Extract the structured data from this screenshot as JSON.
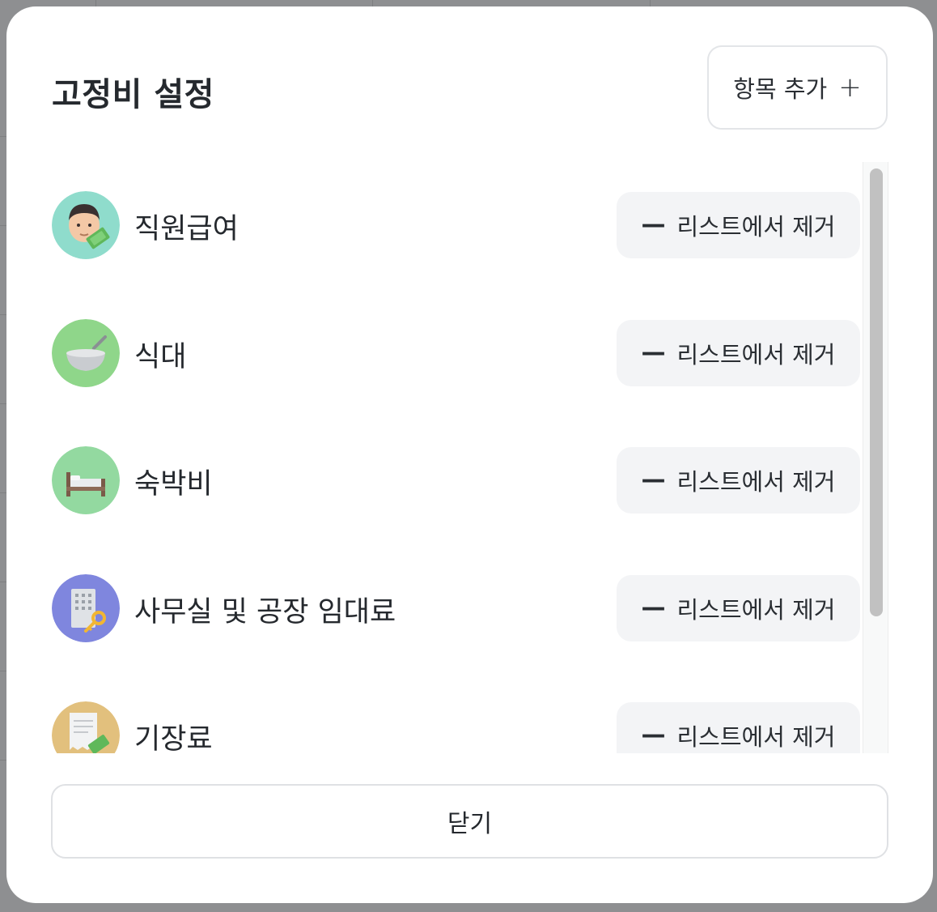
{
  "modal": {
    "title": "고정비 설정",
    "add_button_label": "항목 추가",
    "close_button_label": "닫기"
  },
  "items": [
    {
      "name": "직원급여",
      "remove_label": "리스트에서 제거",
      "icon": "salary-icon",
      "bg": "#8fdccc"
    },
    {
      "name": "식대",
      "remove_label": "리스트에서 제거",
      "icon": "meal-bowl-icon",
      "bg": "#8fd68a"
    },
    {
      "name": "숙박비",
      "remove_label": "리스트에서 제거",
      "icon": "bed-icon",
      "bg": "#93d9a0"
    },
    {
      "name": "사무실 및 공장 임대료",
      "remove_label": "리스트에서 제거",
      "icon": "building-key-icon",
      "bg": "#7f86de"
    },
    {
      "name": "기장료",
      "remove_label": "리스트에서 제거",
      "icon": "bookkeeping-receipt-icon",
      "bg": "#e2c07d"
    }
  ]
}
